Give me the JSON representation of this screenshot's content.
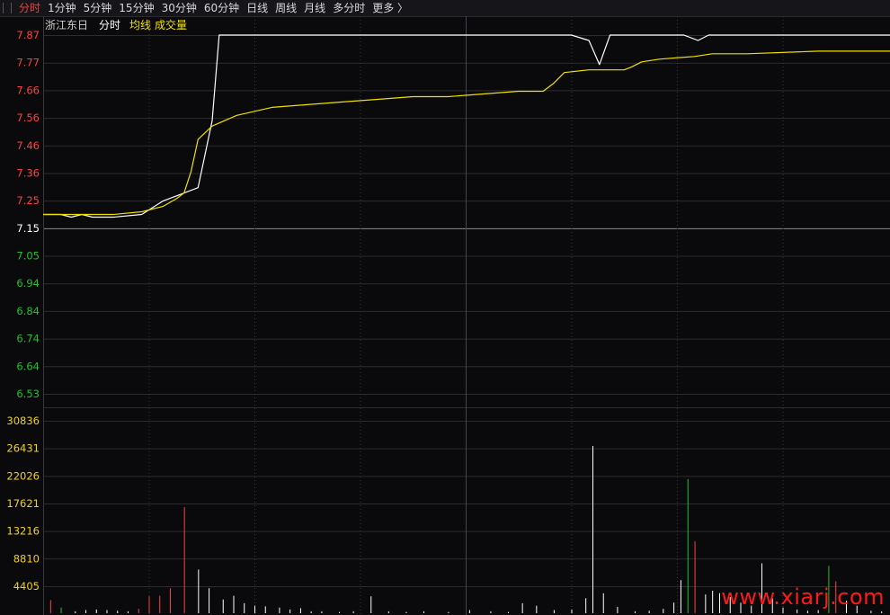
{
  "toolbar": {
    "tabs": [
      "分时",
      "1分钟",
      "5分钟",
      "15分钟",
      "30分钟",
      "60分钟",
      "日线",
      "周线",
      "月线",
      "多分时",
      "更多 〉"
    ],
    "active_index": 0
  },
  "legend": {
    "stock_name": "浙江东日",
    "price_label": "分时",
    "avg_label": "均线",
    "volume_label": "成交量"
  },
  "colors": {
    "up": "#ff4040",
    "down": "#22c02a",
    "neutral": "#ffffff",
    "avg": "#f0e000",
    "grid": "#2c2c30",
    "grid_dotted": "#3a3a40"
  },
  "chart_data": [
    {
      "type": "line",
      "y_ticks": [
        "7.87",
        "7.77",
        "7.66",
        "7.56",
        "7.46",
        "7.36",
        "7.25",
        "7.15",
        "7.05",
        "6.94",
        "6.84",
        "6.74",
        "6.64",
        "6.53"
      ],
      "prev_close": 7.15,
      "ylim": [
        6.53,
        7.87
      ],
      "x_points": 241,
      "series": [
        {
          "role": "price",
          "points": [
            [
              0,
              7.2
            ],
            [
              5,
              7.2
            ],
            [
              8,
              7.19
            ],
            [
              11,
              7.2
            ],
            [
              14,
              7.19
            ],
            [
              20,
              7.19
            ],
            [
              28,
              7.2
            ],
            [
              34,
              7.25
            ],
            [
              40,
              7.28
            ],
            [
              44,
              7.3
            ],
            [
              48,
              7.55
            ],
            [
              50,
              7.87
            ],
            [
              72,
              7.87
            ],
            [
              75,
              7.87
            ],
            [
              110,
              7.87
            ],
            [
              143,
              7.87
            ],
            [
              145,
              7.87
            ],
            [
              150,
              7.87
            ],
            [
              155,
              7.85
            ],
            [
              158,
              7.76
            ],
            [
              161,
              7.87
            ],
            [
              180,
              7.87
            ],
            [
              182,
              7.87
            ],
            [
              186,
              7.85
            ],
            [
              189,
              7.87
            ],
            [
              210,
              7.87
            ],
            [
              241,
              7.87
            ]
          ]
        },
        {
          "role": "average",
          "points": [
            [
              0,
              7.2
            ],
            [
              10,
              7.2
            ],
            [
              20,
              7.2
            ],
            [
              28,
              7.21
            ],
            [
              34,
              7.23
            ],
            [
              38,
              7.26
            ],
            [
              40,
              7.28
            ],
            [
              42,
              7.36
            ],
            [
              44,
              7.48
            ],
            [
              48,
              7.53
            ],
            [
              55,
              7.57
            ],
            [
              65,
              7.6
            ],
            [
              75,
              7.61
            ],
            [
              85,
              7.62
            ],
            [
              95,
              7.63
            ],
            [
              105,
              7.64
            ],
            [
              115,
              7.64
            ],
            [
              125,
              7.65
            ],
            [
              135,
              7.66
            ],
            [
              142,
              7.66
            ],
            [
              145,
              7.69
            ],
            [
              148,
              7.73
            ],
            [
              155,
              7.74
            ],
            [
              165,
              7.74
            ],
            [
              167,
              7.75
            ],
            [
              170,
              7.77
            ],
            [
              175,
              7.78
            ],
            [
              185,
              7.79
            ],
            [
              190,
              7.8
            ],
            [
              200,
              7.8
            ],
            [
              220,
              7.81
            ],
            [
              241,
              7.81
            ]
          ]
        }
      ]
    },
    {
      "type": "bar",
      "y_ticks": [
        "30836",
        "26431",
        "22026",
        "17621",
        "13216",
        "8810",
        "4405"
      ],
      "ylim": [
        0,
        30836
      ],
      "bars": [
        [
          2,
          2100,
          "up"
        ],
        [
          5,
          900,
          "down"
        ],
        [
          9,
          300,
          "n"
        ],
        [
          12,
          500,
          "n"
        ],
        [
          15,
          600,
          "n"
        ],
        [
          18,
          500,
          "n"
        ],
        [
          21,
          400,
          "n"
        ],
        [
          24,
          300,
          "n"
        ],
        [
          27,
          700,
          "up"
        ],
        [
          30,
          2700,
          "up"
        ],
        [
          33,
          2800,
          "up"
        ],
        [
          36,
          4000,
          "up"
        ],
        [
          40,
          17000,
          "up"
        ],
        [
          44,
          7000,
          "n"
        ],
        [
          47,
          4000,
          "n"
        ],
        [
          51,
          2200,
          "n"
        ],
        [
          54,
          2800,
          "n"
        ],
        [
          57,
          1600,
          "n"
        ],
        [
          60,
          1200,
          "n"
        ],
        [
          63,
          1100,
          "n"
        ],
        [
          67,
          900,
          "n"
        ],
        [
          70,
          600,
          "n"
        ],
        [
          73,
          800,
          "n"
        ],
        [
          76,
          300,
          "n"
        ],
        [
          79,
          300,
          "n"
        ],
        [
          84,
          200,
          "n"
        ],
        [
          88,
          300,
          "n"
        ],
        [
          93,
          2700,
          "n"
        ],
        [
          98,
          300,
          "n"
        ],
        [
          103,
          200,
          "n"
        ],
        [
          108,
          300,
          "n"
        ],
        [
          115,
          200,
          "n"
        ],
        [
          121,
          500,
          "n"
        ],
        [
          127,
          300,
          "n"
        ],
        [
          132,
          200,
          "n"
        ],
        [
          136,
          1600,
          "n"
        ],
        [
          140,
          1200,
          "n"
        ],
        [
          145,
          500,
          "n"
        ],
        [
          150,
          600,
          "n"
        ],
        [
          154,
          2400,
          "n"
        ],
        [
          156,
          26800,
          "n"
        ],
        [
          159,
          3200,
          "n"
        ],
        [
          163,
          1000,
          "n"
        ],
        [
          168,
          300,
          "n"
        ],
        [
          172,
          400,
          "n"
        ],
        [
          176,
          700,
          "n"
        ],
        [
          179,
          1700,
          "n"
        ],
        [
          181,
          5300,
          "n"
        ],
        [
          183,
          21500,
          "down"
        ],
        [
          185,
          11500,
          "up"
        ],
        [
          188,
          3000,
          "n"
        ],
        [
          190,
          3600,
          "n"
        ],
        [
          192,
          3200,
          "n"
        ],
        [
          195,
          2600,
          "n"
        ],
        [
          198,
          1700,
          "n"
        ],
        [
          201,
          1200,
          "n"
        ],
        [
          204,
          8000,
          "n"
        ],
        [
          207,
          2400,
          "n"
        ],
        [
          210,
          900,
          "n"
        ],
        [
          214,
          600,
          "n"
        ],
        [
          217,
          400,
          "n"
        ],
        [
          220,
          500,
          "n"
        ],
        [
          223,
          7600,
          "down"
        ],
        [
          225,
          5100,
          "up"
        ],
        [
          228,
          2000,
          "n"
        ],
        [
          231,
          1200,
          "n"
        ],
        [
          235,
          400,
          "n"
        ],
        [
          238,
          300,
          "n"
        ],
        [
          241,
          6000,
          "n"
        ]
      ]
    }
  ],
  "watermark": "www.xiarj.com"
}
